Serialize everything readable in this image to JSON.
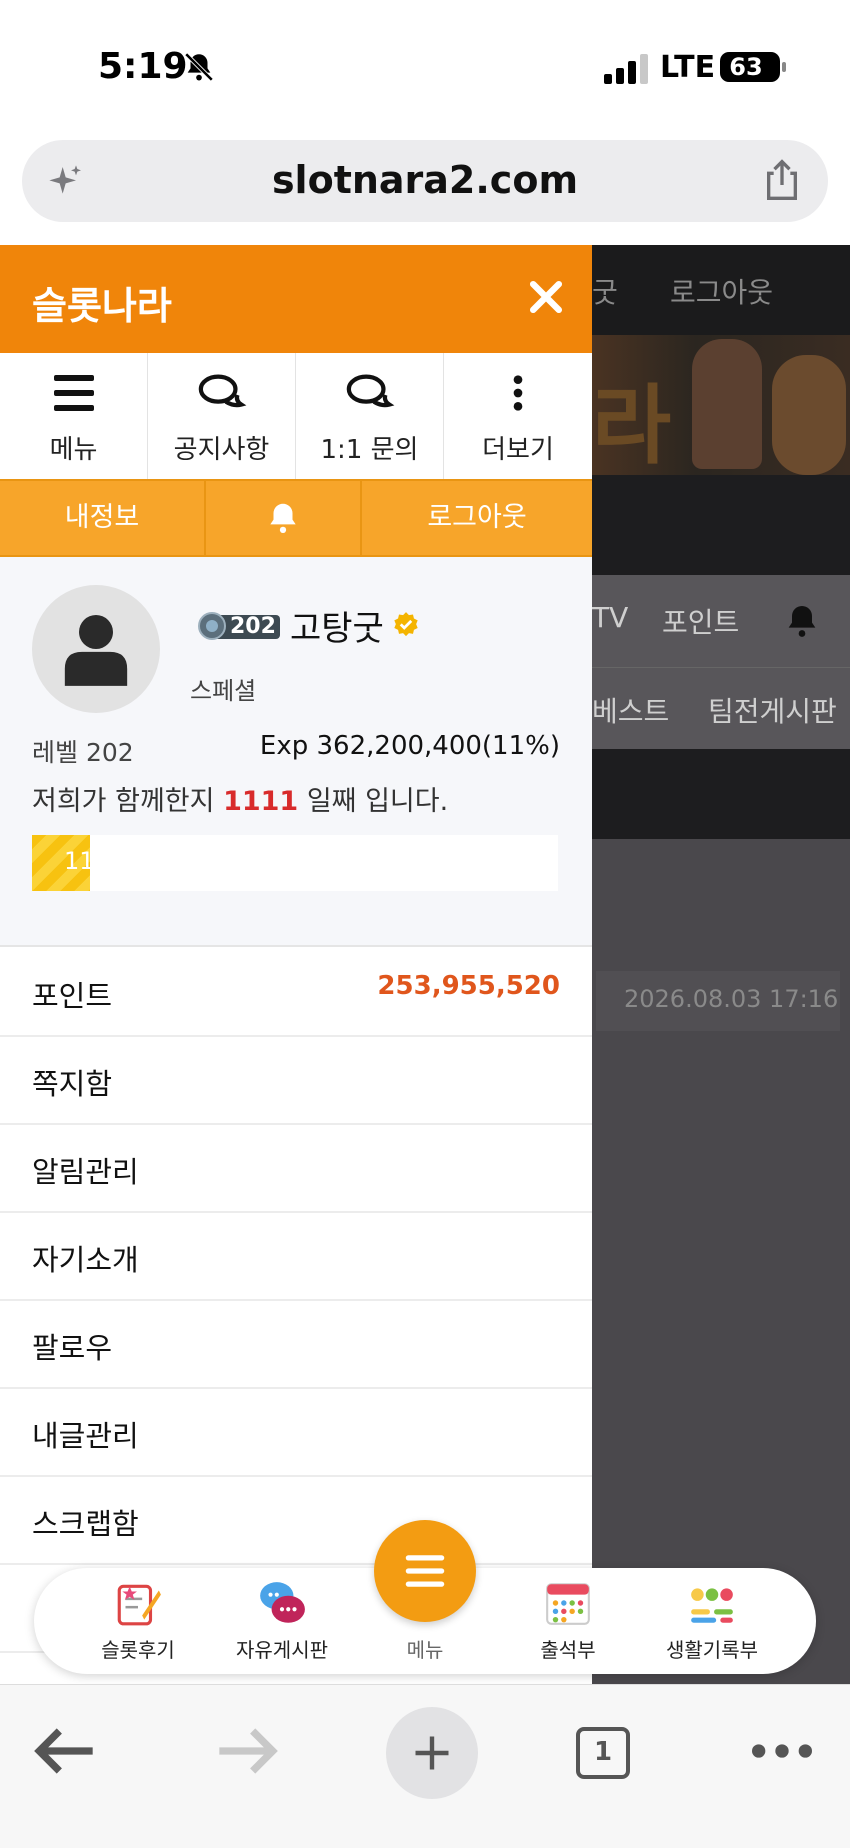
{
  "status_bar": {
    "time": "5:19",
    "network": "LTE",
    "battery": "63"
  },
  "browser": {
    "url": "slotnara2.com",
    "tab_count": "1"
  },
  "background_page": {
    "top_item_partial": "굿",
    "logout": "로그아웃",
    "banner_text": "라",
    "nav1": [
      "TV",
      "포인트"
    ],
    "nav2": [
      "베스트",
      "팀전게시판"
    ],
    "date": "2026.08.03 17:16"
  },
  "drawer": {
    "title": "슬롯나라",
    "quick_menu": [
      {
        "label": "메뉴",
        "icon": "hamburger-icon"
      },
      {
        "label": "공지사항",
        "icon": "chat-bubbles-icon"
      },
      {
        "label": "1:1 문의",
        "icon": "chat-bubbles-icon"
      },
      {
        "label": "더보기",
        "icon": "vertical-dots-icon"
      }
    ],
    "actions": {
      "my_info": "내정보",
      "logout": "로그아웃"
    },
    "profile": {
      "badge_level": "202",
      "username": "고탕굿",
      "grade": "스페셜",
      "level_text": "레벨 202",
      "exp_text": "Exp 362,200,400(11%)",
      "days_prefix": "저희가 함께한지",
      "days_count": "1111",
      "days_suffix": "일째 입니다.",
      "progress_label": "11",
      "progress_percent": 11
    },
    "menu_items": [
      {
        "label": "포인트",
        "value": "253,955,520"
      },
      {
        "label": "쪽지함"
      },
      {
        "label": "알림관리"
      },
      {
        "label": "자기소개"
      },
      {
        "label": "팔로우"
      },
      {
        "label": "내글관리"
      },
      {
        "label": "스크랩함"
      }
    ]
  },
  "bottom_nav": {
    "items": [
      "슬롯후기",
      "자유게시판",
      "메뉴",
      "출석부",
      "생활기록부"
    ]
  },
  "colors": {
    "accent": "#f0850a",
    "accent_light": "#f7a52a",
    "points": "#e0561c",
    "days": "#d82b2b"
  }
}
